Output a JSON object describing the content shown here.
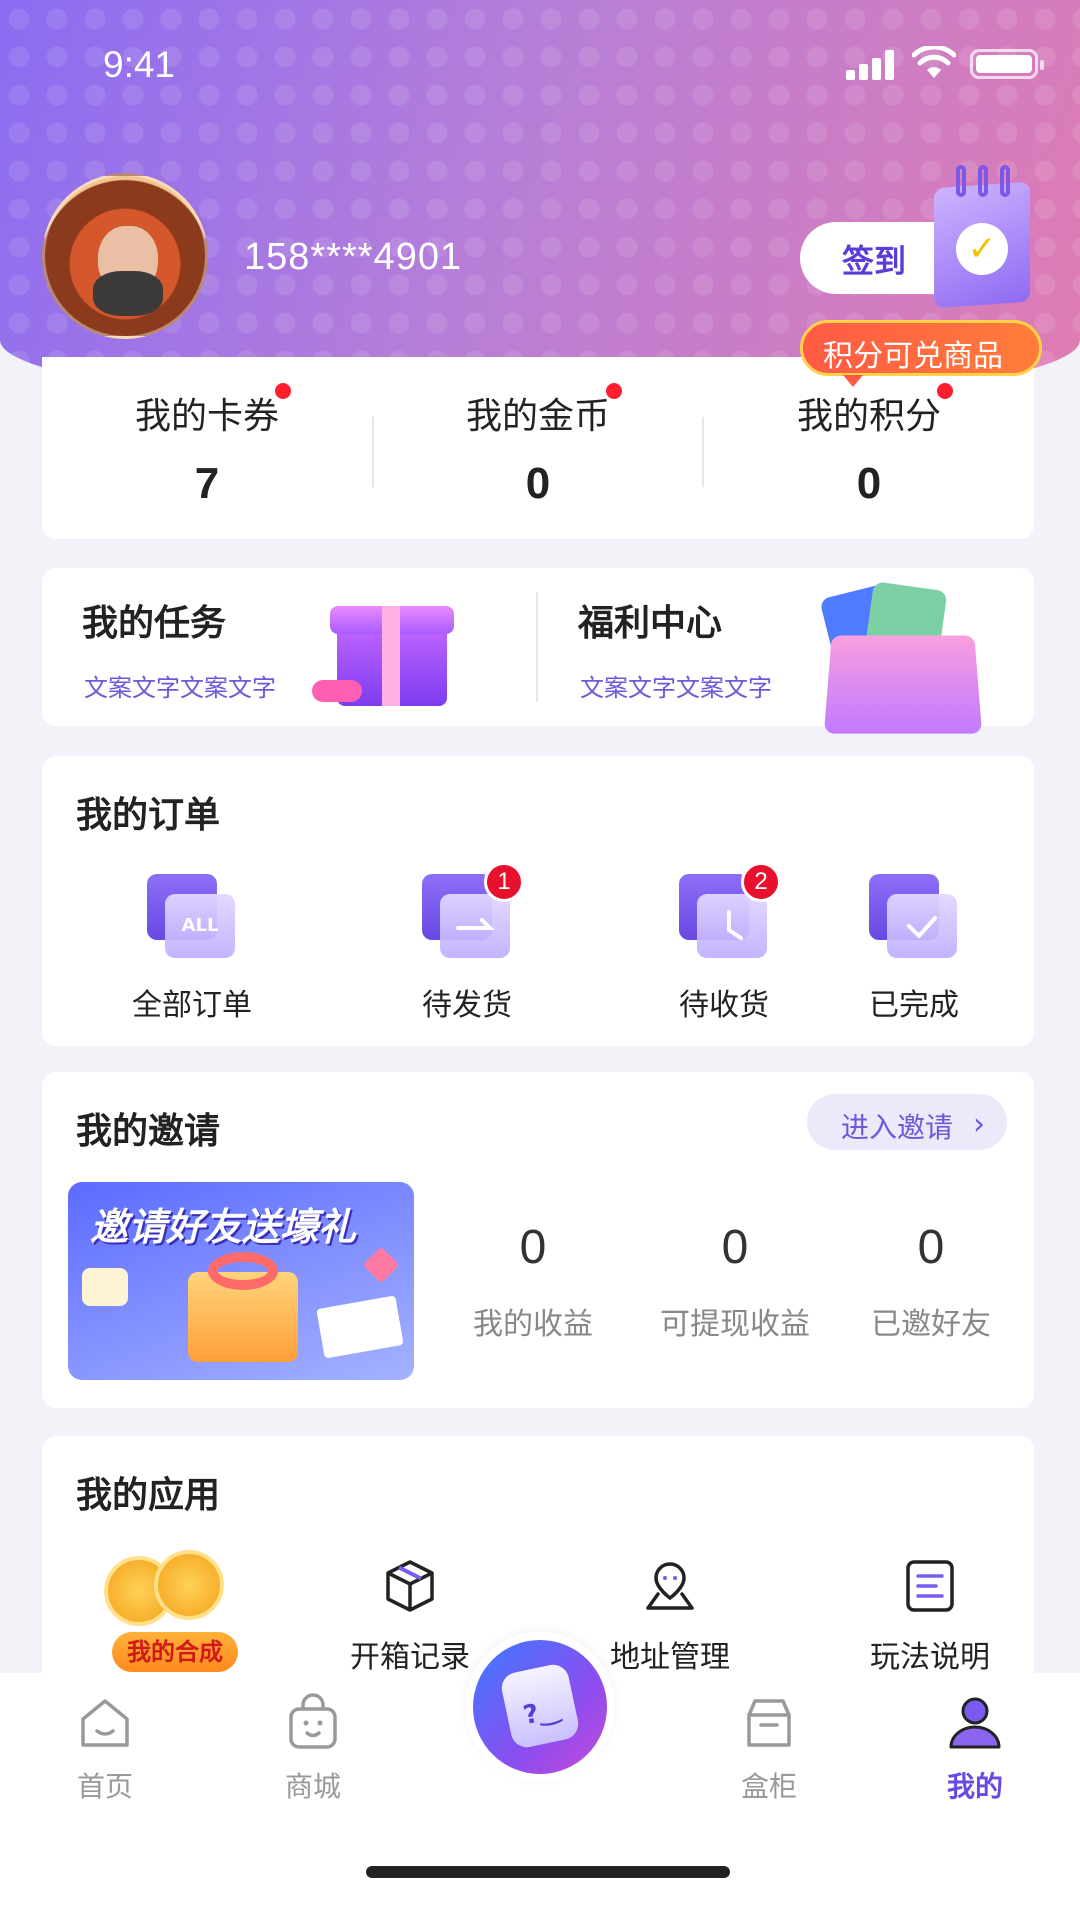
{
  "status_bar": {
    "time": "9:41"
  },
  "profile": {
    "phone": "158****4901"
  },
  "checkin": {
    "label": "签到"
  },
  "points_bubble": {
    "label": "积分可兑商品"
  },
  "stats": [
    {
      "label": "我的卡券",
      "value": "7"
    },
    {
      "label": "我的金币",
      "value": "0"
    },
    {
      "label": "我的积分",
      "value": "0"
    }
  ],
  "promo": {
    "tasks": {
      "title": "我的任务",
      "subtitle": "文案文字文案文字"
    },
    "welfare": {
      "title": "福利中心",
      "subtitle": "文案文字文案文字"
    }
  },
  "orders": {
    "title": "我的订单",
    "items": [
      {
        "label": "全部订单",
        "icon_text": "ALL",
        "badge": ""
      },
      {
        "label": "待发货",
        "icon_text": "",
        "badge": "1"
      },
      {
        "label": "待收货",
        "icon_text": "",
        "badge": "2"
      },
      {
        "label": "已完成",
        "icon_text": "",
        "badge": ""
      }
    ]
  },
  "invite": {
    "title": "我的邀请",
    "link_label": "进入邀请",
    "banner_title": "邀请好友送壕礼",
    "stats": [
      {
        "value": "0",
        "label": "我的收益"
      },
      {
        "value": "0",
        "label": "可提现收益"
      },
      {
        "value": "0",
        "label": "已邀好友"
      }
    ]
  },
  "apps": {
    "title": "我的应用",
    "items": [
      {
        "label": "我的合成",
        "icon": "coins-merge-icon"
      },
      {
        "label": "开箱记录",
        "icon": "box-icon"
      },
      {
        "label": "地址管理",
        "icon": "location-icon"
      },
      {
        "label": "玩法说明",
        "icon": "document-icon"
      }
    ]
  },
  "tabbar": [
    {
      "label": "首页",
      "icon": "home-icon",
      "active": false
    },
    {
      "label": "商城",
      "icon": "shop-bag-icon",
      "active": false
    },
    {
      "label": "盒柜",
      "icon": "cabinet-icon",
      "active": false
    },
    {
      "label": "我的",
      "icon": "user-icon",
      "active": true
    }
  ],
  "colors": {
    "accent": "#6a48e2",
    "badge": "#e8112d",
    "link": "#6a5ad9"
  }
}
